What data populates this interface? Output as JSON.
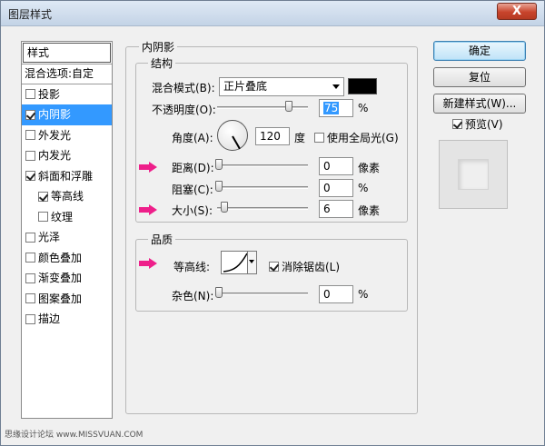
{
  "window": {
    "title": "图层样式",
    "close_label": "X"
  },
  "style_list": {
    "header": "样式",
    "blend_options": "混合选项:自定",
    "items": [
      {
        "label": "投影",
        "checked": false
      },
      {
        "label": "内阴影",
        "checked": true,
        "selected": true
      },
      {
        "label": "外发光",
        "checked": false
      },
      {
        "label": "内发光",
        "checked": false
      },
      {
        "label": "斜面和浮雕",
        "checked": true
      },
      {
        "label": "等高线",
        "checked": true,
        "sub": true
      },
      {
        "label": "纹理",
        "checked": false,
        "sub": true
      },
      {
        "label": "光泽",
        "checked": false
      },
      {
        "label": "颜色叠加",
        "checked": false
      },
      {
        "label": "渐变叠加",
        "checked": false
      },
      {
        "label": "图案叠加",
        "checked": false
      },
      {
        "label": "描边",
        "checked": false
      }
    ]
  },
  "panel": {
    "title": "内阴影",
    "structure": {
      "title": "结构",
      "blend_mode_label": "混合模式(B):",
      "blend_mode_value": "正片叠底",
      "shadow_color": "#000000",
      "opacity_label": "不透明度(O):",
      "opacity_value": "75",
      "opacity_unit": "%",
      "angle_label": "角度(A):",
      "angle_value": "120",
      "angle_unit": "度",
      "global_light_label": "使用全局光(G)",
      "global_light_checked": false,
      "distance_label": "距离(D):",
      "distance_value": "0",
      "distance_unit": "像素",
      "choke_label": "阻塞(C):",
      "choke_value": "0",
      "choke_unit": "%",
      "size_label": "大小(S):",
      "size_value": "6",
      "size_unit": "像素"
    },
    "quality": {
      "title": "品质",
      "contour_label": "等高线:",
      "anti_alias_label": "消除锯齿(L)",
      "anti_alias_checked": true,
      "noise_label": "杂色(N):",
      "noise_value": "0",
      "noise_unit": "%"
    }
  },
  "buttons": {
    "ok": "确定",
    "reset": "复位",
    "new_style": "新建样式(W)...",
    "preview_label": "预览(V)",
    "preview_checked": true
  },
  "watermark": "思缘设计论坛 www.MISSVUAN.COM",
  "colors": {
    "selection": "#3399ff",
    "arrow_marker": "#ee1f8a"
  }
}
